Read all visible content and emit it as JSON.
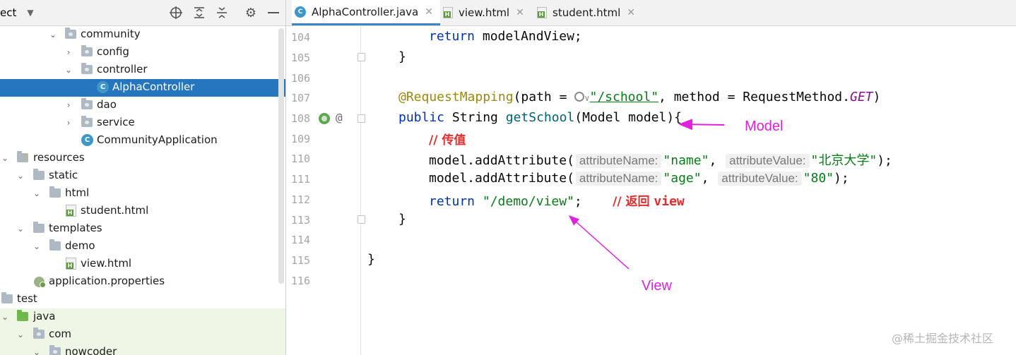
{
  "project_panel": {
    "title": "ect",
    "toolbar_icons": [
      "crosshair-icon",
      "expand-all-icon",
      "collapse-all-icon",
      "gear-icon",
      "minimize-icon"
    ]
  },
  "tree": [
    {
      "label": "community",
      "icon": "package-folder",
      "expanded": true
    },
    {
      "label": "config",
      "icon": "package-folder",
      "expanded": false
    },
    {
      "label": "controller",
      "icon": "package-folder",
      "expanded": true
    },
    {
      "label": "AlphaController",
      "icon": "class-icon",
      "selected": true
    },
    {
      "label": "dao",
      "icon": "package-folder",
      "expanded": false
    },
    {
      "label": "service",
      "icon": "package-folder",
      "expanded": false
    },
    {
      "label": "CommunityApplication",
      "icon": "spring-app-icon"
    },
    {
      "label": "resources",
      "icon": "resources-folder",
      "expanded": true
    },
    {
      "label": "static",
      "icon": "folder",
      "expanded": true
    },
    {
      "label": "html",
      "icon": "folder",
      "expanded": true
    },
    {
      "label": "student.html",
      "icon": "html-file-icon"
    },
    {
      "label": "templates",
      "icon": "folder",
      "expanded": true
    },
    {
      "label": "demo",
      "icon": "folder",
      "expanded": true
    },
    {
      "label": "view.html",
      "icon": "html-file-icon"
    },
    {
      "label": "application.properties",
      "icon": "properties-file-icon"
    },
    {
      "label": "test",
      "icon": "folder",
      "expanded": true
    },
    {
      "label": "java",
      "icon": "source-folder",
      "expanded": true
    },
    {
      "label": "com",
      "icon": "package-folder",
      "expanded": true
    },
    {
      "label": "nowcoder",
      "icon": "package-folder",
      "expanded": true
    }
  ],
  "tabs": [
    {
      "label": "AlphaController.java",
      "active": true,
      "icon": "java-class-icon"
    },
    {
      "label": "view.html",
      "active": false,
      "icon": "html-file-icon"
    },
    {
      "label": "student.html",
      "active": false,
      "icon": "html-file-icon"
    }
  ],
  "line_numbers": [
    "104",
    "105",
    "106",
    "107",
    "108",
    "109",
    "110",
    "111",
    "112",
    "113",
    "114",
    "115",
    "116"
  ],
  "code": {
    "l104_kw": "return",
    "l104_rest": " modelAndView;",
    "l105": "}",
    "l107_ann": "@RequestMapping",
    "l107_a": "(path = ",
    "l107_str": "\"/school\"",
    "l107_b": ", method = RequestMethod.",
    "l107_const": "GET",
    "l107_c": ")",
    "l108_kw": "public",
    "l108_type": " String ",
    "l108_fn": "getSchool",
    "l108_rest": "(Model model){",
    "l109_comment": "// 传值",
    "l110_a": "model.addAttribute(",
    "l110_hint1": "attributeName:",
    "l110_str1": "\"name\"",
    "l110_comma": ",",
    "l110_hint2": "attributeValue:",
    "l110_str2": "\"北京大学\"",
    "l110_end": ");",
    "l111_a": "model.addAttribute(",
    "l111_hint1": "attributeName:",
    "l111_str1": "\"age\"",
    "l111_comma": ",",
    "l111_hint2": "attributeValue:",
    "l111_str2": "\"80\"",
    "l111_end": ");",
    "l112_kw": "return",
    "l112_str": "\"/demo/view\"",
    "l112_semi": ";",
    "l112_comment_cn": "// 返回 ",
    "l112_comment_code": "view",
    "l113": "}",
    "l115": "}"
  },
  "annotations": {
    "model_label": "Model",
    "view_label": "View",
    "arrow_color": "#e021e0"
  },
  "watermark": "@稀土掘金技术社区"
}
